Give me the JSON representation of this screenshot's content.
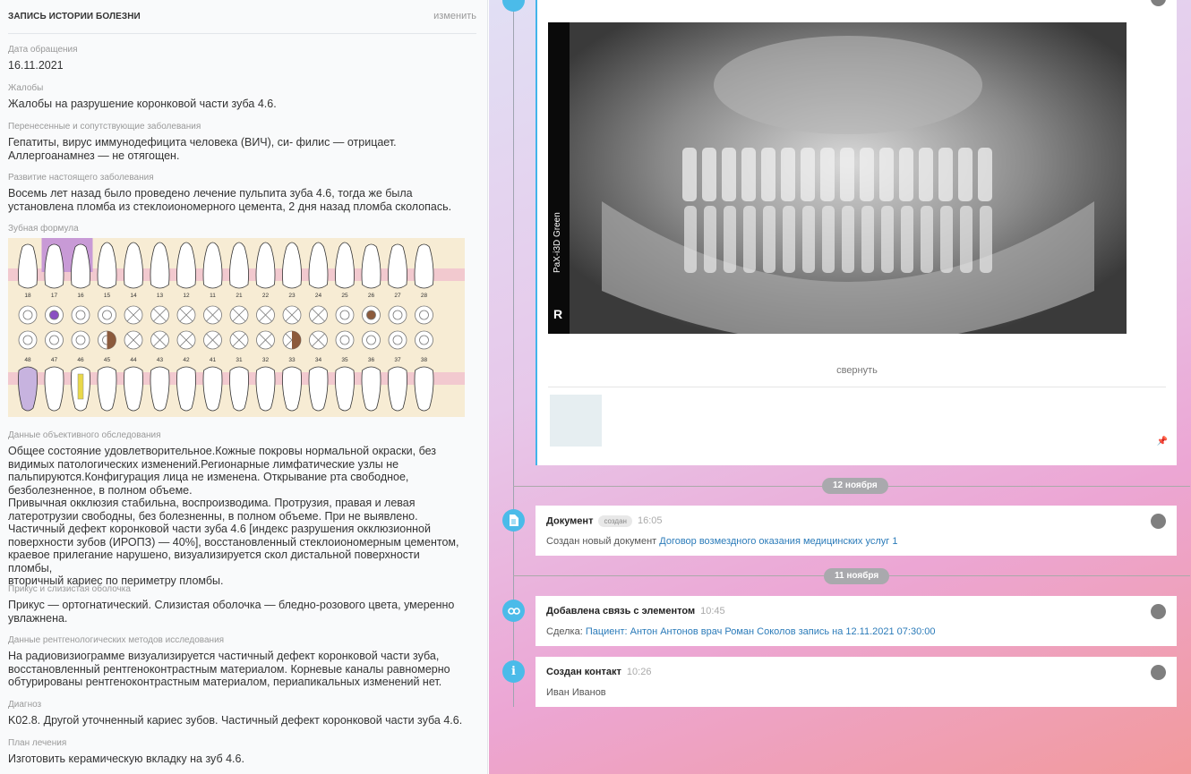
{
  "record": {
    "title": "ЗАПИСЬ ИСТОРИИ БОЛЕЗНИ",
    "edit_label": "изменить",
    "fields": [
      {
        "label": "Дата обращения",
        "value": "16.11.2021"
      },
      {
        "label": "Жалобы",
        "value": "Жалобы на разрушение коронковой части зуба 4.6."
      },
      {
        "label": "Перенесенные и сопутствующие заболевания",
        "value": "Гепатиты, вирус иммунодефицита человека (ВИЧ), си- филис — отрицает.\nАллергоанамнез — не отягощен."
      },
      {
        "label": "Развитие настоящего заболевания",
        "value": "Восемь лет назад было проведено лечение пульпита зуба 4.6, тогда же была\nустановлена пломба из стеклоиономерного цемента, 2 дня назад пломба сколопась."
      },
      {
        "label": "Зубная формула",
        "value": ""
      },
      {
        "label": "Данные объективного обследования",
        "value": "Общее состояние удовлетворительное.Кожные покровы нормальной окраски, без\nвидимых патологических изменений.Регионарные лимфатические узлы не\nпальпируются.Конфигурация лица не изменена. Открывание рта свободное,\nбезболезненное, в полном объеме.\nПривычная окклюзия стабильна, воспроизводима. Протрузия, правая и левая\nлатеротрузии свободны, без болезненны, в полном объеме. При не выявлено.\nЧастичный дефект коронковой части зуба 4.6 [индекс разрушения окклюзионной\nповерхности зубов (ИРОПЗ) — 40%], восстановленный стеклоиономерным цементом,\nкраевое прилегание нарушено, визуализируется скол дистальной поверхности пломбы,\nвторичный кариес по периметру пломбы."
      },
      {
        "label": "Прикус и слизистая оболочка",
        "value": "Прикус — ортогнатический. Слизистая оболочка — бледно-розового цвета, умеренно\nувлажнена."
      },
      {
        "label": "Данные рентгенологических методов исследования",
        "value": "На радиовизиограмме визуализируется частичный дефект коронковой части зуба,\nвосстановленный рентгеноконтрастным материалом. Корневые каналы равномерно\nобтурированы рентгеноконтрастным материалом, периапикальных изменений нет."
      },
      {
        "label": "Диагноз",
        "value": "K02.8. Другой уточненный кариес зубов. Частичный дефект коронковой части зуба 4.6."
      },
      {
        "label": "План лечения",
        "value": "Изготовить керамическую вкладку на зуб 4.6."
      }
    ],
    "teeth_upper": [
      "18",
      "17",
      "16",
      "15",
      "14",
      "13",
      "12",
      "11",
      "21",
      "22",
      "23",
      "24",
      "25",
      "26",
      "27",
      "28"
    ],
    "teeth_lower": [
      "48",
      "47",
      "46",
      "45",
      "44",
      "43",
      "42",
      "41",
      "31",
      "32",
      "33",
      "34",
      "35",
      "36",
      "37",
      "38"
    ]
  },
  "feed": {
    "xray_brand": "PaX-i3D Green",
    "xray_marker": "R",
    "collapse_label": "свернуть",
    "dates": [
      "12 ноября",
      "11 ноября"
    ],
    "events": [
      {
        "title": "Документ",
        "badge": "создан",
        "time": "16:05",
        "text": "Создан новый документ ",
        "link": "Договор возмездного оказания медицинских услуг 1",
        "icon": "document-icon"
      },
      {
        "title": "Добавлена связь с элементом",
        "time": "10:45",
        "text": "Сделка: ",
        "link": "Пациент: Антон Антонов врач Роман Соколов запись на 12.11.2021 07:30:00",
        "icon": "link-icon"
      },
      {
        "title": "Создан контакт",
        "time": "10:26",
        "text": "Иван Иванов",
        "icon": "info-icon"
      }
    ]
  },
  "colors": {
    "accent": "#42b4ea",
    "link": "#2b7bb9",
    "highlight_tooth": "#c89ad6",
    "caries": "#8b5a3c",
    "filling": "#e9d84a"
  }
}
